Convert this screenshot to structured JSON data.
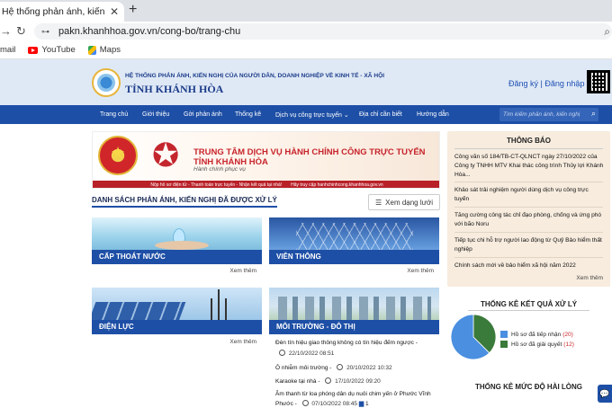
{
  "browser": {
    "tab_title": "Hệ thống phản ánh, kiến nghị củ",
    "url": "pakn.khanhhoa.gov.vn/cong-bo/trang-chu",
    "bookmarks": [
      {
        "label": "mail",
        "icon": "gmail-icon"
      },
      {
        "label": "YouTube",
        "icon": "youtube-icon"
      },
      {
        "label": "Maps",
        "icon": "maps-icon"
      }
    ]
  },
  "header": {
    "subtitle": "HỆ THỐNG PHẢN ÁNH, KIẾN NGHỊ CỦA NGƯỜI DÂN, DOANH NGHIỆP VỀ KINH TẾ - XÃ HỘI",
    "title": "TỈNH KHÁNH HÒA",
    "register": "Đăng ký",
    "separator": "|",
    "login": "Đăng nhập"
  },
  "nav": {
    "items": [
      "Trang chủ",
      "Giới thiệu",
      "Gởi phản ánh",
      "Thống kê",
      "Dịch vụ công trực tuyến ⌄",
      "Địa chỉ cần biết",
      "Hướng dẫn"
    ],
    "search_placeholder": "Tìm kiếm phản ánh, kiến nghị"
  },
  "banner": {
    "line1": "TRUNG TÂM DỊCH VỤ HÀNH CHÍNH CÔNG TRỰC TUYẾN",
    "line2": "TỈNH KHÁNH HÒA",
    "line3": "Hành chính phục vụ",
    "strip": [
      "Nộp hồ sơ điện tử - Thanh toán trực tuyến - Nhận kết quả tại nhà!",
      "Hãy truy cập hanhchinhcong.khanhhoa.gov.vn"
    ]
  },
  "main": {
    "section_title": "DANH SÁCH PHẢN ÁNH, KIẾN NGHỊ ĐÃ ĐƯỢC XỬ LÝ",
    "grid_button": "Xem dạng lưới",
    "more": "Xem thêm",
    "cards": [
      "CẤP THOÁT NƯỚC",
      "VIỄN THÔNG",
      "ĐIỆN LỰC",
      "MÔI TRƯỜNG - ĐÔ THỊ"
    ],
    "news": [
      {
        "title": "Đèn tín hiệu giao thông không có tín hiệu đếm ngược -",
        "date": "22/10/2022 08:51"
      },
      {
        "title": "Ô nhiễm môi trường -",
        "date": "20/10/2022 10:32"
      },
      {
        "title": "Karaoke tại nhà -",
        "date": "17/10/2022 09:20"
      },
      {
        "title": "Âm thanh từ loa phóng dân dụ nuôi chim yến ở Phước Vĩnh",
        "date": ""
      },
      {
        "title": "Phước -",
        "date": "07/10/2022 08:45",
        "comments": "1"
      }
    ]
  },
  "sidebar": {
    "notice_title": "THÔNG BÁO",
    "notices": [
      [
        "Công văn số 184/TB-CT-QLNCT ngày 27/10/2022 của",
        "Công ty TNHH MTV Khai thác công trình Thủy lợi Khánh",
        "Hòa..."
      ],
      [
        "Khảo sát trải nghiệm người dùng dịch vụ công trực",
        "tuyến"
      ],
      [
        "Tăng cường công tác chỉ đạo phòng, chống và ứng phó",
        "với bão Noru"
      ],
      [
        "Tiếp tục chi hỗ trợ người lao động từ Quỹ Bảo hiểm thất",
        "nghiệp"
      ],
      [
        "Chính sách mới về bảo hiểm xã hội năm 2022"
      ]
    ],
    "notice_more": "Xem thêm",
    "stats_title": "THỐNG KÊ KẾT QUẢ XỬ LÝ",
    "stats2_title": "THỐNG KÊ MỨC ĐỘ HÀI LÒNG"
  },
  "chart_data": {
    "type": "pie",
    "title": "THỐNG KÊ KẾT QUẢ XỬ LÝ",
    "categories": [
      "Hồ sơ đã tiếp nhận",
      "Hồ sơ đã giải quyết"
    ],
    "values": [
      20,
      12
    ],
    "colors": [
      "#4a8fe0",
      "#3a7a3a"
    ]
  }
}
